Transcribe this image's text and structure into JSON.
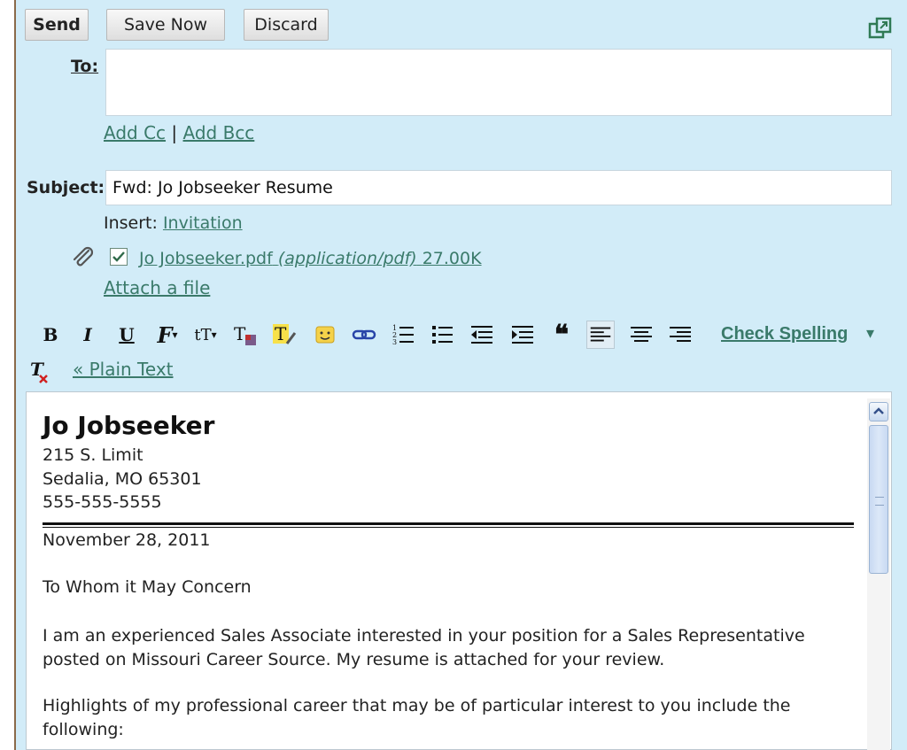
{
  "toolbar_top": {
    "send_label": "Send",
    "save_label": "Save Now",
    "discard_label": "Discard"
  },
  "to": {
    "label": "To:",
    "value": ""
  },
  "cc": {
    "add_cc": "Add Cc",
    "separator": "|",
    "add_bcc": "Add Bcc"
  },
  "subject": {
    "label": "Subject:",
    "value": "Fwd: Jo Jobseeker Resume"
  },
  "insert": {
    "label": "Insert:",
    "invitation": "Invitation"
  },
  "attachment": {
    "checked": true,
    "file_name": "Jo Jobseeker.pdf",
    "mime": "(application/pdf)",
    "size": "27.00K",
    "attach_link": "Attach a file"
  },
  "format_toolbar": {
    "items": [
      "bold-icon",
      "italic-icon",
      "underline-icon",
      "font-icon",
      "font-size-icon",
      "text-color-icon",
      "highlight-icon",
      "emoticon-icon",
      "link-icon",
      "numbered-list-icon",
      "bulleted-list-icon",
      "indent-less-icon",
      "indent-more-icon",
      "blockquote-icon",
      "align-left-icon",
      "align-center-icon",
      "align-right-icon"
    ],
    "check_spelling": "Check Spelling",
    "check_arrow": "▾",
    "plain_text": "« Plain Text"
  },
  "body": {
    "name": "Jo Jobseeker",
    "street": "215 S. Limit",
    "city": "Sedalia, MO 65301",
    "phone": "555-555-5555",
    "date": "November 28, 2011",
    "greeting": "To Whom it May Concern",
    "para1_line1": "I am an experienced Sales Associate interested in your position for a Sales Representative",
    "para1_line2": "posted on Missouri Career Source. My resume is attached for your review.",
    "para2_line1": "Highlights of my professional career that may be of particular interest to you include the",
    "para2_line2": "following:"
  },
  "colors": {
    "panel_bg": "#d2ecf8",
    "link": "#3a7a6a"
  }
}
